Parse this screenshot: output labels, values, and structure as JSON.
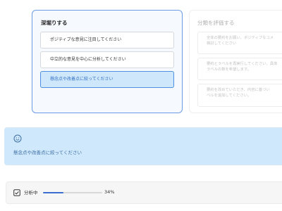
{
  "deep_dive": {
    "title": "深堀りする",
    "options": [
      {
        "label": "ポジティブな意見に注目してください",
        "selected": false
      },
      {
        "label": "中立的な意見を中心に分析してください",
        "selected": false
      },
      {
        "label": "懸念点や改善点に絞ってください",
        "selected": true
      }
    ]
  },
  "evaluate": {
    "title": "分類を評価する",
    "items": [
      {
        "line1": "全体の要約をお願い、ポジティブなコメ",
        "line2": "検討してください"
      },
      {
        "line1": "要約とラベルを再実行してください、具体",
        "line2": "ラベルの数を希望します。"
      },
      {
        "line1": "要約を改めていただき、内容に基づい",
        "line2": "ベルを追加してください。"
      }
    ]
  },
  "banner": {
    "icon": "smiley-icon",
    "text": "懸念点や改善点に絞ってください"
  },
  "progress": {
    "icon": "analysis-icon",
    "label": "分析中",
    "percent_text": "34%",
    "value": 0.34
  },
  "colors": {
    "accent": "#3a6fd1",
    "selected_bg": "#cfe7fb",
    "banner_bg": "#cfe8fb"
  }
}
